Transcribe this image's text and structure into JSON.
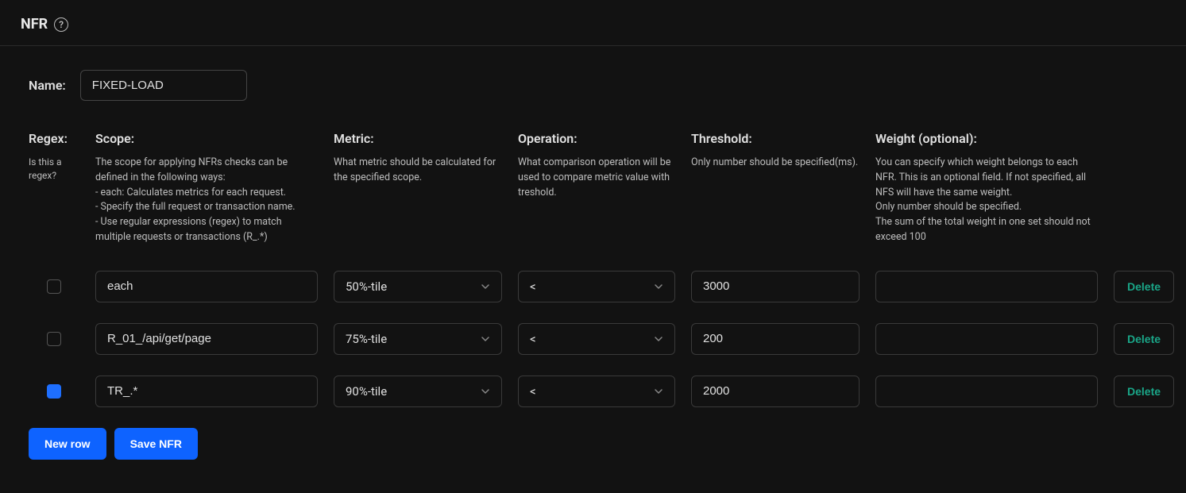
{
  "header": {
    "title": "NFR"
  },
  "name": {
    "label": "Name:",
    "value": "FIXED-LOAD"
  },
  "columns": {
    "regex": {
      "head": "Regex:",
      "desc": "Is this a regex?"
    },
    "scope": {
      "head": "Scope:",
      "desc": "The scope for applying NFRs checks can be defined in the following ways:\n- each: Calculates metrics for each request.\n- Specify the full request or transaction name.\n- Use regular expressions (regex) to match multiple requests or transactions (R_.*)"
    },
    "metric": {
      "head": "Metric:",
      "desc": "What metric should be calculated for the specified scope."
    },
    "operation": {
      "head": "Operation:",
      "desc": "What comparison operation will be used to compare metric value with treshold."
    },
    "threshold": {
      "head": "Threshold:",
      "desc": "Only number should be specified(ms)."
    },
    "weight": {
      "head": "Weight (optional):",
      "desc": "You can specify which weight belongs to each NFR. This is an optional field. If not specified, all NFS will have the same weight.\nOnly number should be specified.\nThe sum of the total weight in one set should not exceed 100"
    }
  },
  "rows": [
    {
      "regex": false,
      "scope": "each",
      "metric": "50%-tile",
      "operation": "<",
      "threshold": "3000",
      "weight": ""
    },
    {
      "regex": false,
      "scope": "R_01_/api/get/page",
      "metric": "75%-tile",
      "operation": "<",
      "threshold": "200",
      "weight": ""
    },
    {
      "regex": true,
      "scope": "TR_.*",
      "metric": "90%-tile",
      "operation": "<",
      "threshold": "2000",
      "weight": ""
    }
  ],
  "buttons": {
    "delete": "Delete",
    "newRow": "New row",
    "saveNFR": "Save NFR"
  }
}
